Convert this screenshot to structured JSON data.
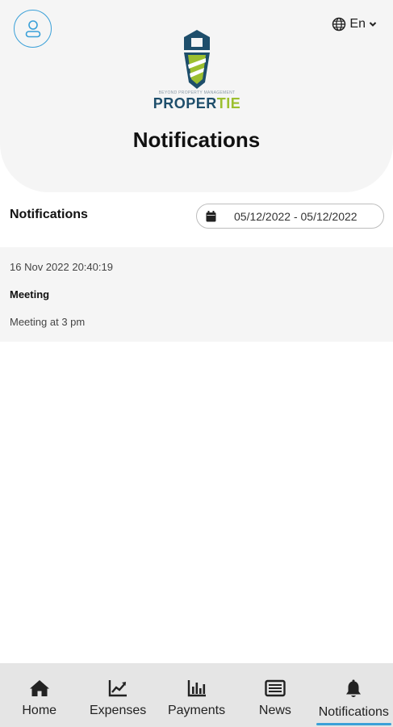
{
  "header": {
    "language": "En",
    "logo": {
      "tagline": "BEYOND PROPERTY MANAGEMENT",
      "word_part1": "PROPER",
      "word_part2": "TIE"
    },
    "title": "Notifications"
  },
  "section": {
    "title": "Notifications",
    "date_range": "05/12/2022 - 05/12/2022"
  },
  "notifications": [
    {
      "timestamp": "16 Nov 2022 20:40:19",
      "title": "Meeting",
      "body": "Meeting at 3 pm"
    }
  ],
  "bottom_nav": {
    "items": [
      {
        "label": "Home",
        "icon": "home-icon"
      },
      {
        "label": "Expenses",
        "icon": "chart-line-icon"
      },
      {
        "label": "Payments",
        "icon": "bar-chart-icon"
      },
      {
        "label": "News",
        "icon": "newspaper-icon"
      },
      {
        "label": "Notifications",
        "icon": "bell-icon"
      }
    ],
    "active": "Notifications"
  },
  "colors": {
    "accent": "#3aa0d8",
    "brand_dark": "#1e4e6b",
    "brand_green": "#9cbf2f",
    "header_bg": "#f5f5f5",
    "nav_bg": "#e5e5e5"
  }
}
